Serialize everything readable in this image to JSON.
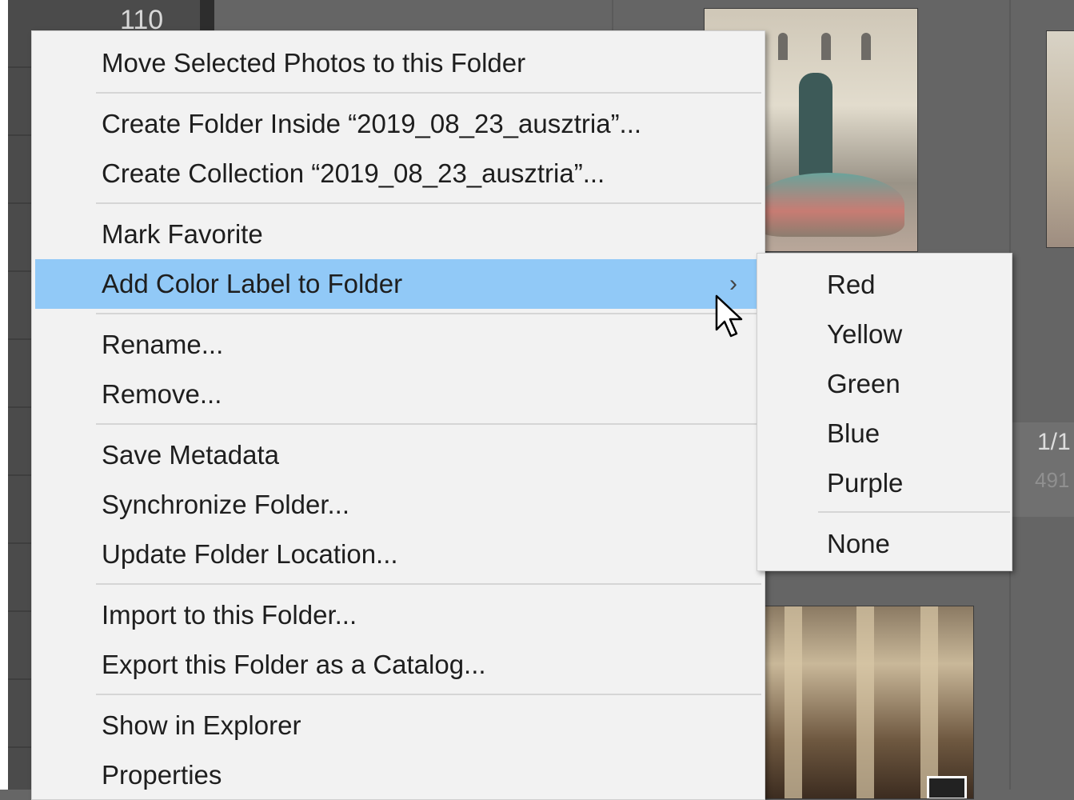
{
  "background": {
    "panel_number": "110",
    "grid_meta": {
      "line1": "1/1",
      "line2": "491"
    }
  },
  "context_menu": {
    "items": [
      {
        "label": "Move Selected Photos to this Folder"
      },
      {
        "label": "Create Folder Inside “2019_08_23_ausztria”..."
      },
      {
        "label": "Create Collection “2019_08_23_ausztria”..."
      },
      {
        "label": "Mark Favorite"
      },
      {
        "label": "Add Color Label to Folder",
        "highlighted": true,
        "submenu_arrow": "›"
      },
      {
        "label": "Rename..."
      },
      {
        "label": "Remove..."
      },
      {
        "label": "Save Metadata"
      },
      {
        "label": "Synchronize Folder..."
      },
      {
        "label": "Update Folder Location..."
      },
      {
        "label": "Import to this Folder..."
      },
      {
        "label": "Export this Folder as a Catalog..."
      },
      {
        "label": "Show in Explorer"
      },
      {
        "label": "Properties"
      }
    ]
  },
  "color_label_submenu": {
    "items": [
      {
        "label": "Red"
      },
      {
        "label": "Yellow"
      },
      {
        "label": "Green"
      },
      {
        "label": "Blue"
      },
      {
        "label": "Purple"
      },
      {
        "label": "None"
      }
    ]
  },
  "colors": {
    "highlight": "#91c9f7",
    "menu_background": "#f2f2f2",
    "separator": "#d6d6d6",
    "grid_background": "#656565",
    "left_panel": "#4b4b4b"
  },
  "icons": {
    "submenu_arrow": "chevron-right-icon",
    "cursor": "mouse-pointer-icon"
  }
}
